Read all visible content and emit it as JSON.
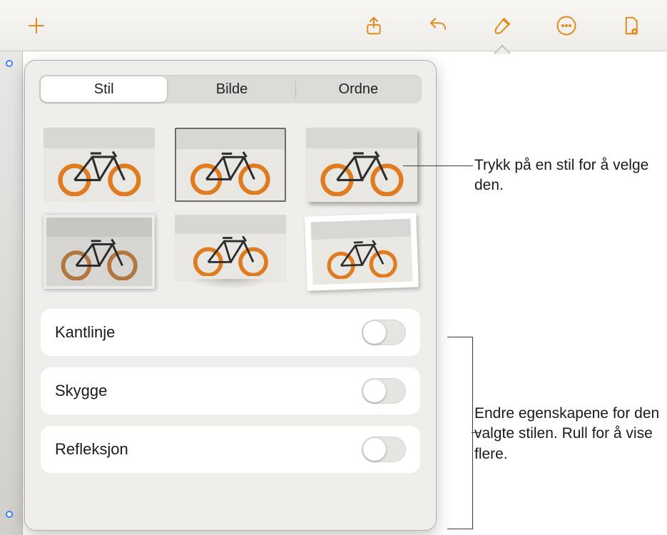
{
  "toolbar": {
    "icons": [
      "add",
      "share",
      "undo",
      "format",
      "more",
      "document-options"
    ]
  },
  "popover": {
    "tabs": [
      {
        "id": "style",
        "label": "Stil",
        "active": true
      },
      {
        "id": "image",
        "label": "Bilde",
        "active": false
      },
      {
        "id": "arrange",
        "label": "Ordne",
        "active": false
      }
    ],
    "style_thumbs": [
      {
        "id": "plain"
      },
      {
        "id": "border"
      },
      {
        "id": "shadow"
      },
      {
        "id": "framed"
      },
      {
        "id": "reflection"
      },
      {
        "id": "polaroid-tilt"
      }
    ],
    "options": [
      {
        "id": "border",
        "label": "Kantlinje",
        "on": false
      },
      {
        "id": "shadow",
        "label": "Skygge",
        "on": false
      },
      {
        "id": "reflection",
        "label": "Refleksjon",
        "on": false
      }
    ]
  },
  "callouts": {
    "c1": "Trykk på en stil for å velge den.",
    "c2": "Endre egenskapene for den valgte stilen. Rull for å vise flere."
  }
}
